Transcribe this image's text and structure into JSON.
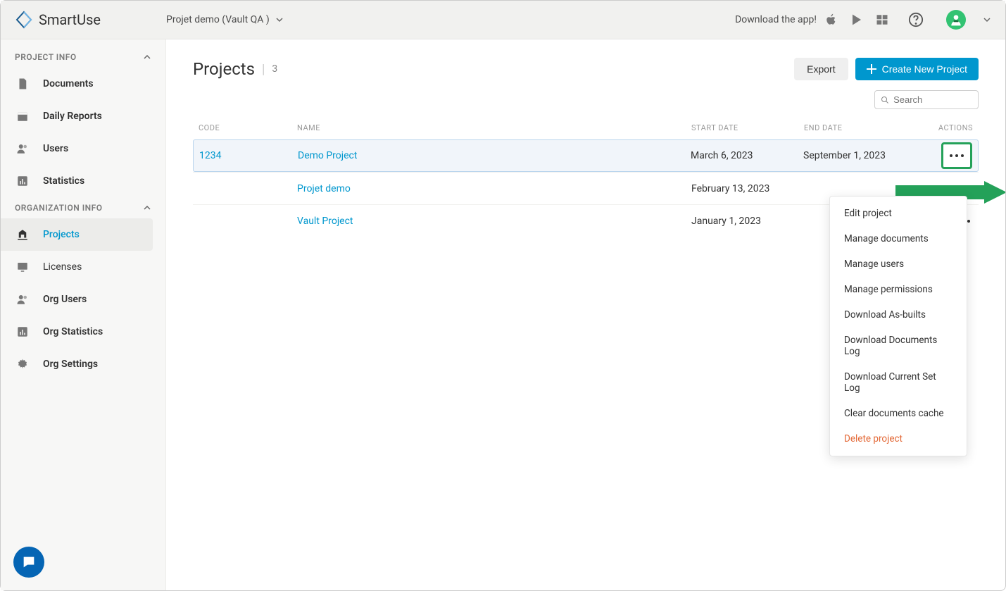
{
  "brand": "SmartUse",
  "header": {
    "project_selector": "Projet demo (Vault QA )",
    "download_label": "Download the app!"
  },
  "sidebar": {
    "section1": "PROJECT INFO",
    "items1": [
      "Documents",
      "Daily Reports",
      "Users",
      "Statistics"
    ],
    "section2": "ORGANIZATION INFO",
    "items2": [
      "Projects",
      "Licenses",
      "Org Users",
      "Org Statistics",
      "Org Settings"
    ]
  },
  "page": {
    "title": "Projects",
    "count": "3",
    "export_label": "Export",
    "create_label": "Create New Project",
    "search_placeholder": "Search"
  },
  "columns": {
    "code": "CODE",
    "name": "NAME",
    "start": "START DATE",
    "end": "END DATE",
    "actions": "ACTIONS"
  },
  "rows": [
    {
      "code": "1234",
      "name": "Demo Project",
      "start": "March 6, 2023",
      "end": "September 1, 2023"
    },
    {
      "code": "",
      "name": "Projet demo",
      "start": "February 13, 2023",
      "end": ""
    },
    {
      "code": "",
      "name": "Vault Project",
      "start": "January 1, 2023",
      "end": ""
    }
  ],
  "menu": [
    "Edit project",
    "Manage documents",
    "Manage users",
    "Manage permissions",
    "Download As-builts",
    "Download Documents Log",
    "Download Current Set Log",
    "Clear documents cache",
    "Delete project"
  ]
}
